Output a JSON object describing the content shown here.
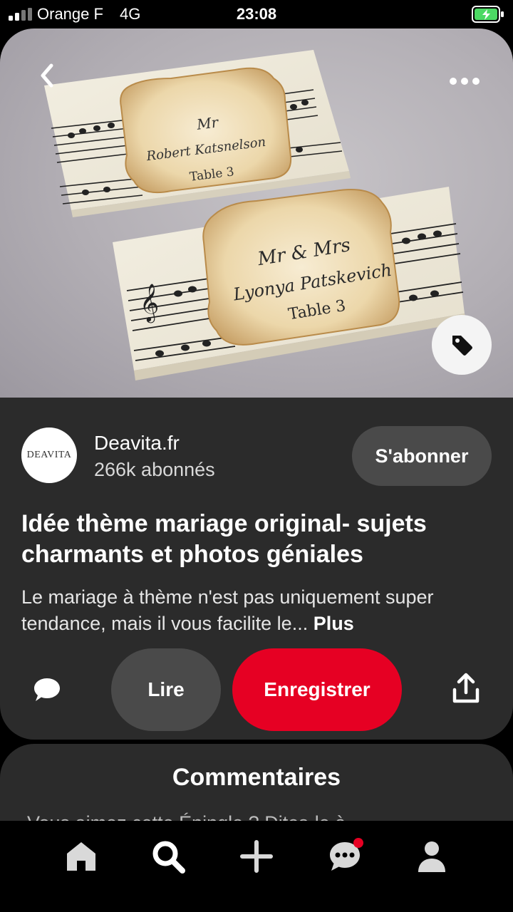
{
  "status_bar": {
    "carrier": "Orange F",
    "network": "4G",
    "time": "23:08",
    "battery_color": "#4cd964"
  },
  "photo": {
    "card_back": {
      "line1": "Mr",
      "line2": "Robert Katsnelson",
      "line3": "Table 3"
    },
    "card_front": {
      "line1": "Mr & Mrs",
      "line2": "Lyonya Patskevich",
      "line3": "Table 3"
    }
  },
  "author": {
    "avatar_text": "DEAVITA",
    "name": "Deavita.fr",
    "followers": "266k abonnés",
    "subscribe_label": "S'abonner"
  },
  "pin": {
    "title": "Idée thème mariage original- sujets charmants et photos géniales",
    "description": "Le mariage à thème n'est pas uniquement super tendance, mais il vous facilite le...",
    "more_label": "Plus"
  },
  "actions": {
    "read_label": "Lire",
    "save_label": "Enregistrer",
    "save_color": "#e60023"
  },
  "comments": {
    "title": "Commentaires",
    "hint": "Vous aimez cette Épingle ? Dites-le à"
  },
  "nav": {
    "items": [
      "home-icon",
      "search-icon",
      "plus-icon",
      "messages-icon",
      "profile-icon"
    ]
  }
}
